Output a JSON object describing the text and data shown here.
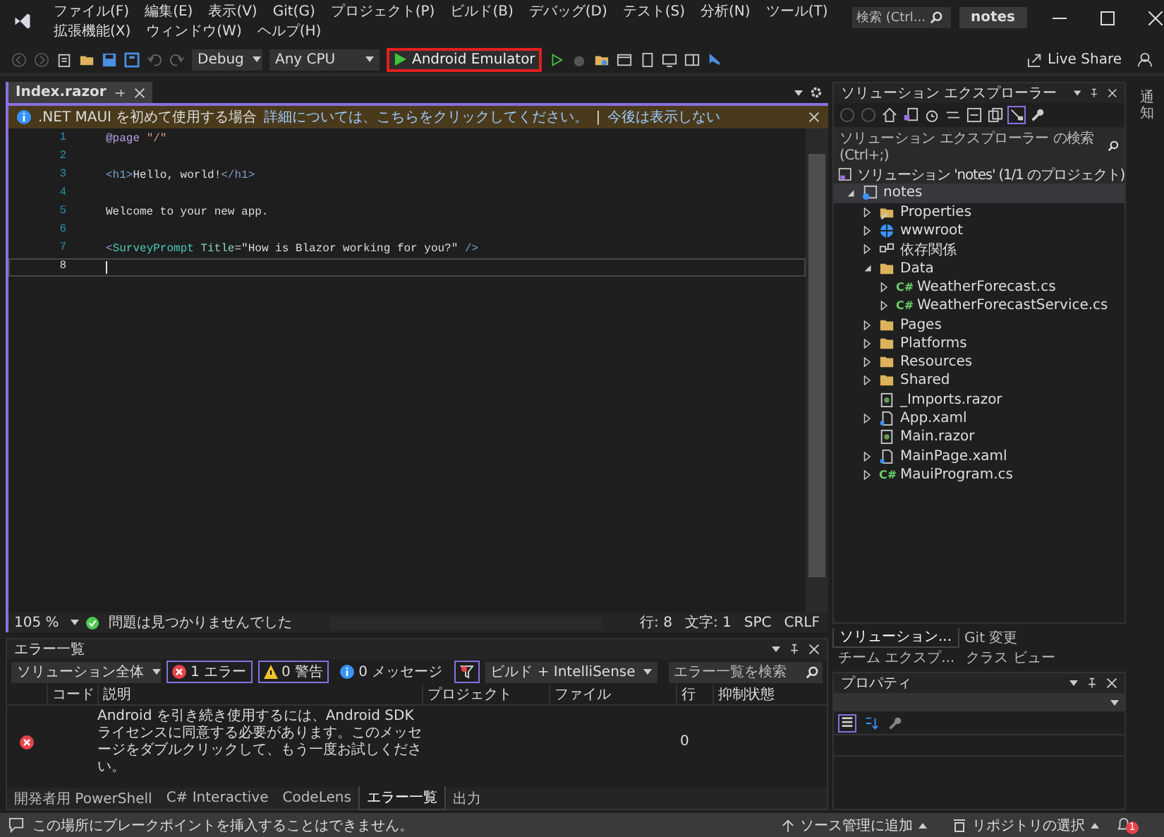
{
  "menu": [
    "ファイル(F)",
    "編集(E)",
    "表示(V)",
    "Git(G)",
    "プロジェクト(P)",
    "ビルド(B)",
    "デバッグ(D)",
    "テスト(S)",
    "分析(N)",
    "ツール(T)",
    "拡張機能(X)",
    "ウィンドウ(W)",
    "ヘルプ(H)"
  ],
  "title_search": {
    "placeholder": "検索 (Ctrl..."
  },
  "solution_name": "notes",
  "toolbar": {
    "configuration": "Debug",
    "platform": "Any CPU",
    "run_target": "Android Emulator",
    "live_share": "Live Share"
  },
  "editor": {
    "tabs": [
      {
        "label": "Index.razor",
        "selected": true
      }
    ],
    "infobar": {
      "message": ".NET MAUI を初めて使用する場合",
      "link": "詳細については、こちらをクリックしてください。",
      "separator": "|",
      "dismiss": "今後は表示しない"
    },
    "lines": [
      {
        "number": "1",
        "current": false,
        "tokens": [
          {
            "text": "@page",
            "kind": "directive"
          },
          {
            "text": " \"/\"",
            "kind": "string"
          }
        ]
      },
      {
        "number": "2",
        "current": false
      },
      {
        "number": "3",
        "current": false,
        "tokens": [
          {
            "text": "<h1>",
            "kind": "tag"
          },
          {
            "text": "Hello, world!",
            "kind": "text"
          },
          {
            "text": "</h1>",
            "kind": "tag"
          }
        ]
      },
      {
        "number": "4",
        "current": false
      },
      {
        "number": "5",
        "current": false,
        "tokens": [
          {
            "text": "Welcome to your new app.",
            "kind": "text"
          }
        ]
      },
      {
        "number": "6",
        "current": false
      },
      {
        "number": "7",
        "current": false,
        "tokens": [
          {
            "text": "<",
            "kind": "tag"
          },
          {
            "text": "SurveyPrompt",
            "kind": "component"
          },
          {
            "text": " Title",
            "kind": "attribute"
          },
          {
            "text": "=\"How is Blazor working for you?\"",
            "kind": "text"
          },
          {
            "text": " />",
            "kind": "tag"
          }
        ]
      },
      {
        "number": "8",
        "current": true
      }
    ],
    "zoom": "105 %",
    "status": "問題は見つかりませんでした",
    "line": "行: 8",
    "column": "文字: 1",
    "whitespace": "SPC",
    "line_ending": "CRLF"
  },
  "error_list": {
    "title": "エラー一覧",
    "scope": "ソリューション全体",
    "filters": [
      {
        "label": "1 エラー",
        "kind": "error",
        "on": true
      },
      {
        "label": "0 警告",
        "kind": "warning",
        "on": true
      },
      {
        "label": "0 メッセージ",
        "kind": "info",
        "on": false
      }
    ],
    "source": "ビルド + IntelliSense",
    "search_placeholder": "エラー一覧を検索",
    "columns": [
      "コード",
      "説明",
      "プロジェクト",
      "ファイル",
      "行",
      "抑制状態"
    ],
    "rows": [
      {
        "kind": "error",
        "description": "Android を引き続き使用するには、Android SDK ライセンスに同意する必要があります。このメッセージをダブルクリックして、もう一度お試しください。",
        "line": "0"
      }
    ]
  },
  "bottom_tabs": [
    {
      "label": "開発者用 PowerShell",
      "selected": false
    },
    {
      "label": "C# Interactive",
      "selected": false
    },
    {
      "label": "CodeLens",
      "selected": false
    },
    {
      "label": "エラー一覧",
      "selected": true
    },
    {
      "label": "出力",
      "selected": false
    }
  ],
  "solution_explorer": {
    "title": "ソリューション エクスプローラー",
    "search_placeholder": "ソリューション エクスプローラー の検索 (Ctrl+;)",
    "solution": "ソリューション 'notes' (1/1 のプロジェクト)",
    "tree": [
      {
        "label": "notes",
        "kind": "project",
        "expanded": true,
        "selected": true,
        "children": [
          {
            "label": "Properties",
            "kind": "properties",
            "expanded": false,
            "selected": false
          },
          {
            "label": "wwwroot",
            "kind": "globe",
            "expanded": false,
            "selected": false
          },
          {
            "label": "依存関係",
            "kind": "dependencies",
            "expanded": false,
            "selected": false
          },
          {
            "label": "Data",
            "kind": "folder",
            "expanded": true,
            "selected": false,
            "children": [
              {
                "label": "WeatherForecast.cs",
                "kind": "csharp",
                "icon_text": "C#",
                "expanded": false,
                "selected": false
              },
              {
                "label": "WeatherForecastService.cs",
                "kind": "csharp",
                "icon_text": "C#",
                "expanded": false,
                "selected": false
              }
            ]
          },
          {
            "label": "Pages",
            "kind": "folder",
            "expanded": false,
            "selected": false
          },
          {
            "label": "Platforms",
            "kind": "folder",
            "expanded": false,
            "selected": false
          },
          {
            "label": "Resources",
            "kind": "folder",
            "expanded": false,
            "selected": false
          },
          {
            "label": "Shared",
            "kind": "folder",
            "expanded": false,
            "selected": false
          },
          {
            "label": "_Imports.razor",
            "kind": "razor",
            "selected": false
          },
          {
            "label": "App.xaml",
            "kind": "xaml",
            "expanded": false,
            "selected": false
          },
          {
            "label": "Main.razor",
            "kind": "razor",
            "selected": false
          },
          {
            "label": "MainPage.xaml",
            "kind": "xaml",
            "expanded": false,
            "selected": false
          },
          {
            "label": "MauiProgram.cs",
            "kind": "csharp",
            "icon_text": "C#",
            "expanded": false,
            "selected": false
          }
        ]
      }
    ]
  },
  "side_tabs": [
    {
      "label": "ソリューション...",
      "selected": true
    },
    {
      "label": "Git 変更",
      "selected": false
    },
    {
      "label": "チーム エクスプ...",
      "selected": false
    },
    {
      "label": "クラス ビュー",
      "selected": false
    }
  ],
  "properties": {
    "title": "プロパティ"
  },
  "notifications_tab": "通知",
  "status_bar": {
    "message": "この場所にブレークポイントを挿入することはできません。",
    "source_control": "ソース管理に追加",
    "repository": "リポジトリの選択",
    "notification_count": "1"
  }
}
